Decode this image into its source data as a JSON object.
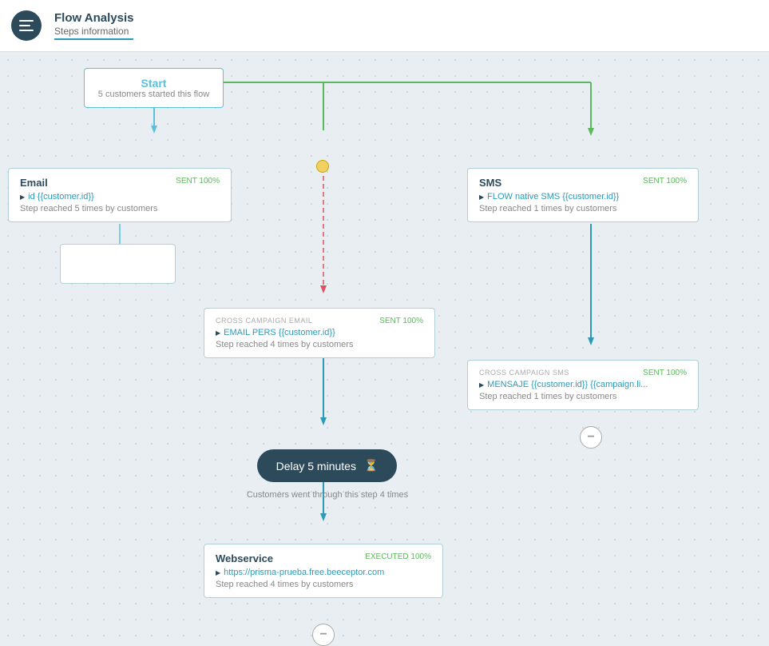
{
  "header": {
    "title": "Flow Analysis",
    "subtitle": "Steps information",
    "icon_lines": [
      4,
      3,
      4
    ]
  },
  "nodes": {
    "start": {
      "label": "Start",
      "stat": "5 customers started this flow"
    },
    "email": {
      "type_label": "Email",
      "status": "SENT 100%",
      "link_text": "id {{customer.id}}",
      "stat": "Step reached 5 times by customers"
    },
    "cross_campaign_email": {
      "type_label": "CROSS CAMPAIGN EMAIL",
      "status": "SENT 100%",
      "link_text": "EMAIL PERS {{customer.id}}",
      "stat": "Step reached 4 times by customers"
    },
    "sms": {
      "type_label": "SMS",
      "status": "SENT 100%",
      "link_text": "FLOW native SMS {{customer.id}}",
      "stat": "Step reached 1 times by customers"
    },
    "cross_campaign_sms": {
      "type_label": "CROSS CAMPAIGN SMS",
      "status": "SENT 100%",
      "link_text": "MENSAJE {{customer.id}} {{campaign.li...",
      "stat": "Step reached 1 times by customers"
    },
    "delay": {
      "label": "Delay 5 minutes",
      "stat": "Customers went through this step 4 times"
    },
    "webservice": {
      "type_label": "Webservice",
      "status": "EXECUTED  100%",
      "link_text": "https://prisma-prueba.free.beeceptor.com",
      "stat": "Step reached 4 times by customers"
    }
  },
  "colors": {
    "teal": "#2c9ab7",
    "dark": "#2c4a5a",
    "green": "#5cb85c",
    "light_border": "#b0d0d8",
    "yellow": "#f0d060"
  }
}
